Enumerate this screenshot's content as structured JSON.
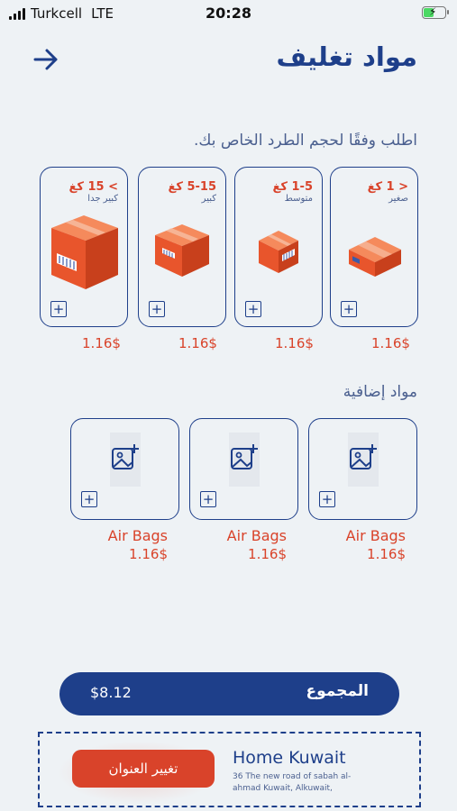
{
  "status_bar": {
    "carrier": "Turkcell",
    "network": "LTE",
    "time": "20:28",
    "battery_level": 0.5
  },
  "header": {
    "title": "مواد تغليف",
    "back_icon": "arrow-right-icon"
  },
  "sizes_section": {
    "title": "اطلب وفقًا لحجم الطرد الخاص بك.",
    "items": [
      {
        "range": "< 1 كغ",
        "label": "صغير",
        "price": "1.16$"
      },
      {
        "range": "1-5 كغ",
        "label": "متوسط",
        "price": "1.16$"
      },
      {
        "range": "5-15 كغ",
        "label": "كبير",
        "price": "1.16$"
      },
      {
        "range": "> 15 كغ",
        "label": "كبير جدا",
        "price": "1.16$"
      }
    ]
  },
  "extras_section": {
    "title": "مواد إضافية",
    "items": [
      {
        "name": "Air Bags",
        "price": "1.16$"
      },
      {
        "name": "Air Bags",
        "price": "1.16$"
      },
      {
        "name": "Air Bags",
        "price": "1.16$"
      }
    ]
  },
  "total": {
    "label": "المجموع",
    "amount": "$8.12"
  },
  "address": {
    "title": "Home Kuwait",
    "text": "36 The new road of sabah al-ahmad Kuwait, Alkuwait,",
    "change_label": "تغيير العنوان"
  },
  "colors": {
    "primary": "#1e3f8a",
    "accent": "#d9432a",
    "background": "#eef2f5",
    "box_orange": "#f06a3c"
  }
}
